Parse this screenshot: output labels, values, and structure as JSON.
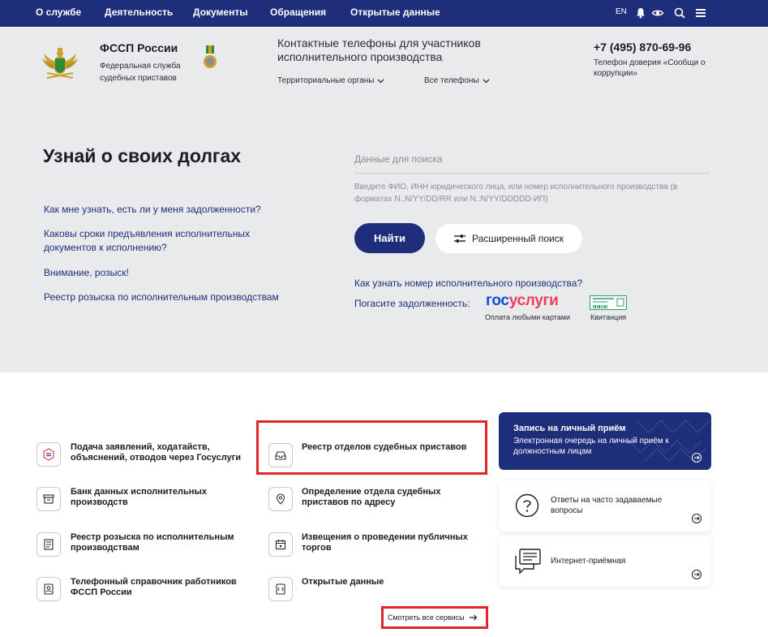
{
  "topnav": {
    "items": [
      "О службе",
      "Деятельность",
      "Документы",
      "Обращения",
      "Открытые данные"
    ],
    "lang": "EN"
  },
  "header": {
    "brand_title": "ФССП России",
    "brand_sub": "Федеральная служба судебных приставов",
    "contacts_title": "Контактные телефоны для участников исполнительного производства",
    "dropdown_territorial": "Территориальные органы",
    "dropdown_phones": "Все телефоны",
    "phone": "+7 (495) 870-69-96",
    "phone_sub": "Телефон доверия «Сообщи о коррупции»"
  },
  "hero": {
    "title": "Узнай о своих долгах",
    "links": [
      "Как мне узнать, есть ли у меня задолженности?",
      "Каковы сроки предъявления исполнительных документов к исполнению?",
      "Внимание, розыск!",
      "Реестр розыска по исполнительным производствам"
    ],
    "search_placeholder": "Данные для поиска",
    "search_hint": "Введите ФИО, ИНН юридического лица, или номер исполнительного производства (в форматах N..N/YY/DD/RR или N..N/YY/DDDDD-ИП)",
    "find_label": "Найти",
    "advanced_label": "Расширенный поиск",
    "how_link": "Как узнать номер исполнительного производства?",
    "pay_label": "Погасите задолженность:",
    "gos_a": "гос",
    "gos_b": "услуги",
    "gos_sub": "Оплата любыми картами",
    "kvit_sub": "Квитанция"
  },
  "services": {
    "left": [
      "Подача заявлений, ходатайств, объяснений, отводов через Госуслуги",
      "Банк данных исполнительных производств",
      "Реестр розыска по исполнительным производствам",
      "Телефонный справочник работников ФССП России"
    ],
    "right": [
      "Реестр отделов судебных приставов",
      "Определение отдела судебных приставов по адресу",
      "Извещения о проведении публичных торгов",
      "Открытые данные"
    ],
    "see_all": "Смотреть все сервисы"
  },
  "cards": {
    "appointment_title": "Запись на личный приём",
    "appointment_sub": "Электронная очередь на личный приём к должностным лицам",
    "faq": "Ответы на часто задаваемые вопросы",
    "reception": "Интернет-приёмная"
  },
  "colors": {
    "brand": "#1f2e7a",
    "highlight": "#e0262c",
    "hero_bg": "#e9eaec"
  }
}
